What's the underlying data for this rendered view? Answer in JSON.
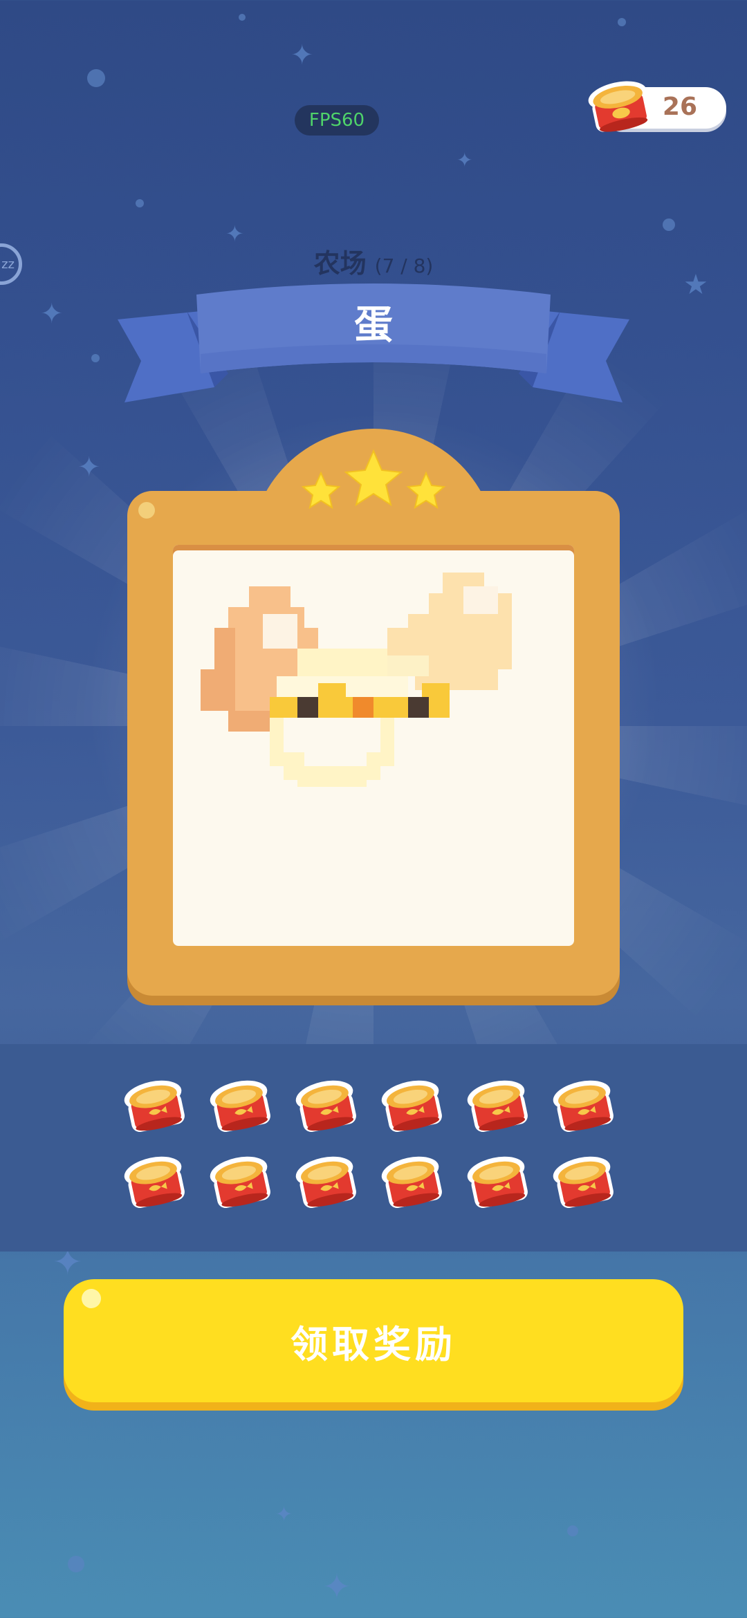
{
  "hud": {
    "fps": "FPS60",
    "coins": "26",
    "sleep_glyph": "zz"
  },
  "level": {
    "category": "农场",
    "progress": "(7 / 8)",
    "title": "蛋",
    "stars_earned": 3,
    "stars_total": 3
  },
  "rewards": {
    "item_icon": "fish-can-icon",
    "count": 12
  },
  "claim_button": {
    "label": "领取奖励"
  },
  "colors": {
    "background_top": "#2f4a86",
    "banner": "#5b79c8",
    "frame": "#e6a84c",
    "button": "#ffde20",
    "can_red": "#e33a2f",
    "can_lid": "#f4b43c"
  }
}
